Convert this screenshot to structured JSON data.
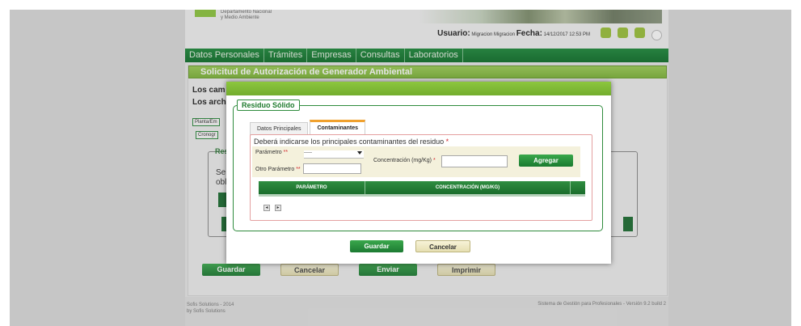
{
  "header": {
    "logo_lines": [
      "Departamento Nacional",
      "y Medio Ambiente"
    ],
    "user_label": "Usuario:",
    "user_name": "Migracion Migracion",
    "date_label": "Fecha:",
    "date_value": "14/12/2017 12:53 PM",
    "icons": [
      "home-icon",
      "print-icon",
      "refresh-icon",
      "gear-icon"
    ]
  },
  "nav": {
    "items": [
      "Datos Personales",
      "Trámites",
      "Empresas",
      "Consultas",
      "Laboratorios"
    ]
  },
  "background": {
    "panel_title": "Solicitud de Autorización de Generador Ambiental",
    "line1": "Los cam",
    "line2": "Los arch",
    "tab1": "Planta/Em",
    "tab2": "Cronogr",
    "fieldset_legend": "Res",
    "fs_line1": "Se in",
    "fs_line2": "oblig",
    "buttons": [
      "Guardar",
      "Cancelar",
      "Enviar",
      "Imprimir"
    ]
  },
  "footer": {
    "left_line1": "Sofis Solutions - 2014",
    "left_line2": "by Sofis Solutions",
    "right": "Sistema de Gestión para Profesionales - Versión 9.2 build 2"
  },
  "modal": {
    "legend": "Residuo Sólido",
    "tabs": [
      "Datos Principales",
      "Contaminantes"
    ],
    "active_tab": 1,
    "instruction": "Deberá indicarse los principales contaminantes del residuo",
    "instruction_req": "*",
    "parametro_label": "Parámetro",
    "parametro_req": "**",
    "parametro_value": "-----",
    "otro_label": "Otro Parámetro",
    "otro_req": "**",
    "otro_value": "",
    "concentracion_label": "Concentración (mg/Kg)",
    "concentracion_req": "*",
    "concentracion_value": "",
    "agregar_label": "Agregar",
    "table_headers": [
      "PARÁMETRO",
      "CONCENTRACIÓN (MG/KG)",
      ""
    ],
    "pager_prev": "◂",
    "pager_next": "▸",
    "guardar_label": "Guardar",
    "cancelar_label": "Cancelar"
  },
  "colors": {
    "nav_green": "#0f6f2a",
    "accent_green": "#8cc63e",
    "tab_orange": "#f0a12e",
    "required_red": "#d2232a"
  }
}
